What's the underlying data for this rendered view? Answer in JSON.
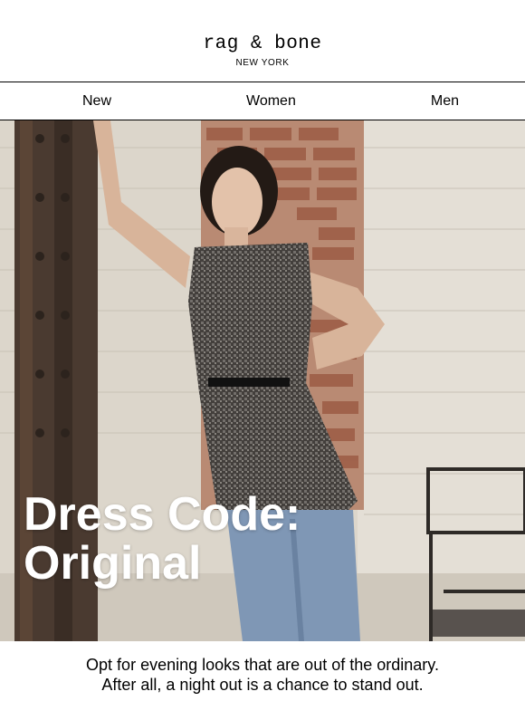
{
  "brand": {
    "logo_text": "rag & bone",
    "location": "NEW YORK"
  },
  "nav": {
    "items": [
      {
        "label": "New"
      },
      {
        "label": "Women"
      },
      {
        "label": "Men"
      }
    ]
  },
  "hero": {
    "headline_line1": "Dress Code:",
    "headline_line2": "Original",
    "image_description_name": "woman-in-tweed-dress-against-brick-wall"
  },
  "copy": {
    "line1": "Opt for evening looks that are out of the ordinary.",
    "line2": "After all, a night out is a chance to stand out."
  },
  "colors": {
    "text": "#000000",
    "background": "#ffffff",
    "headline": "#ffffff"
  }
}
